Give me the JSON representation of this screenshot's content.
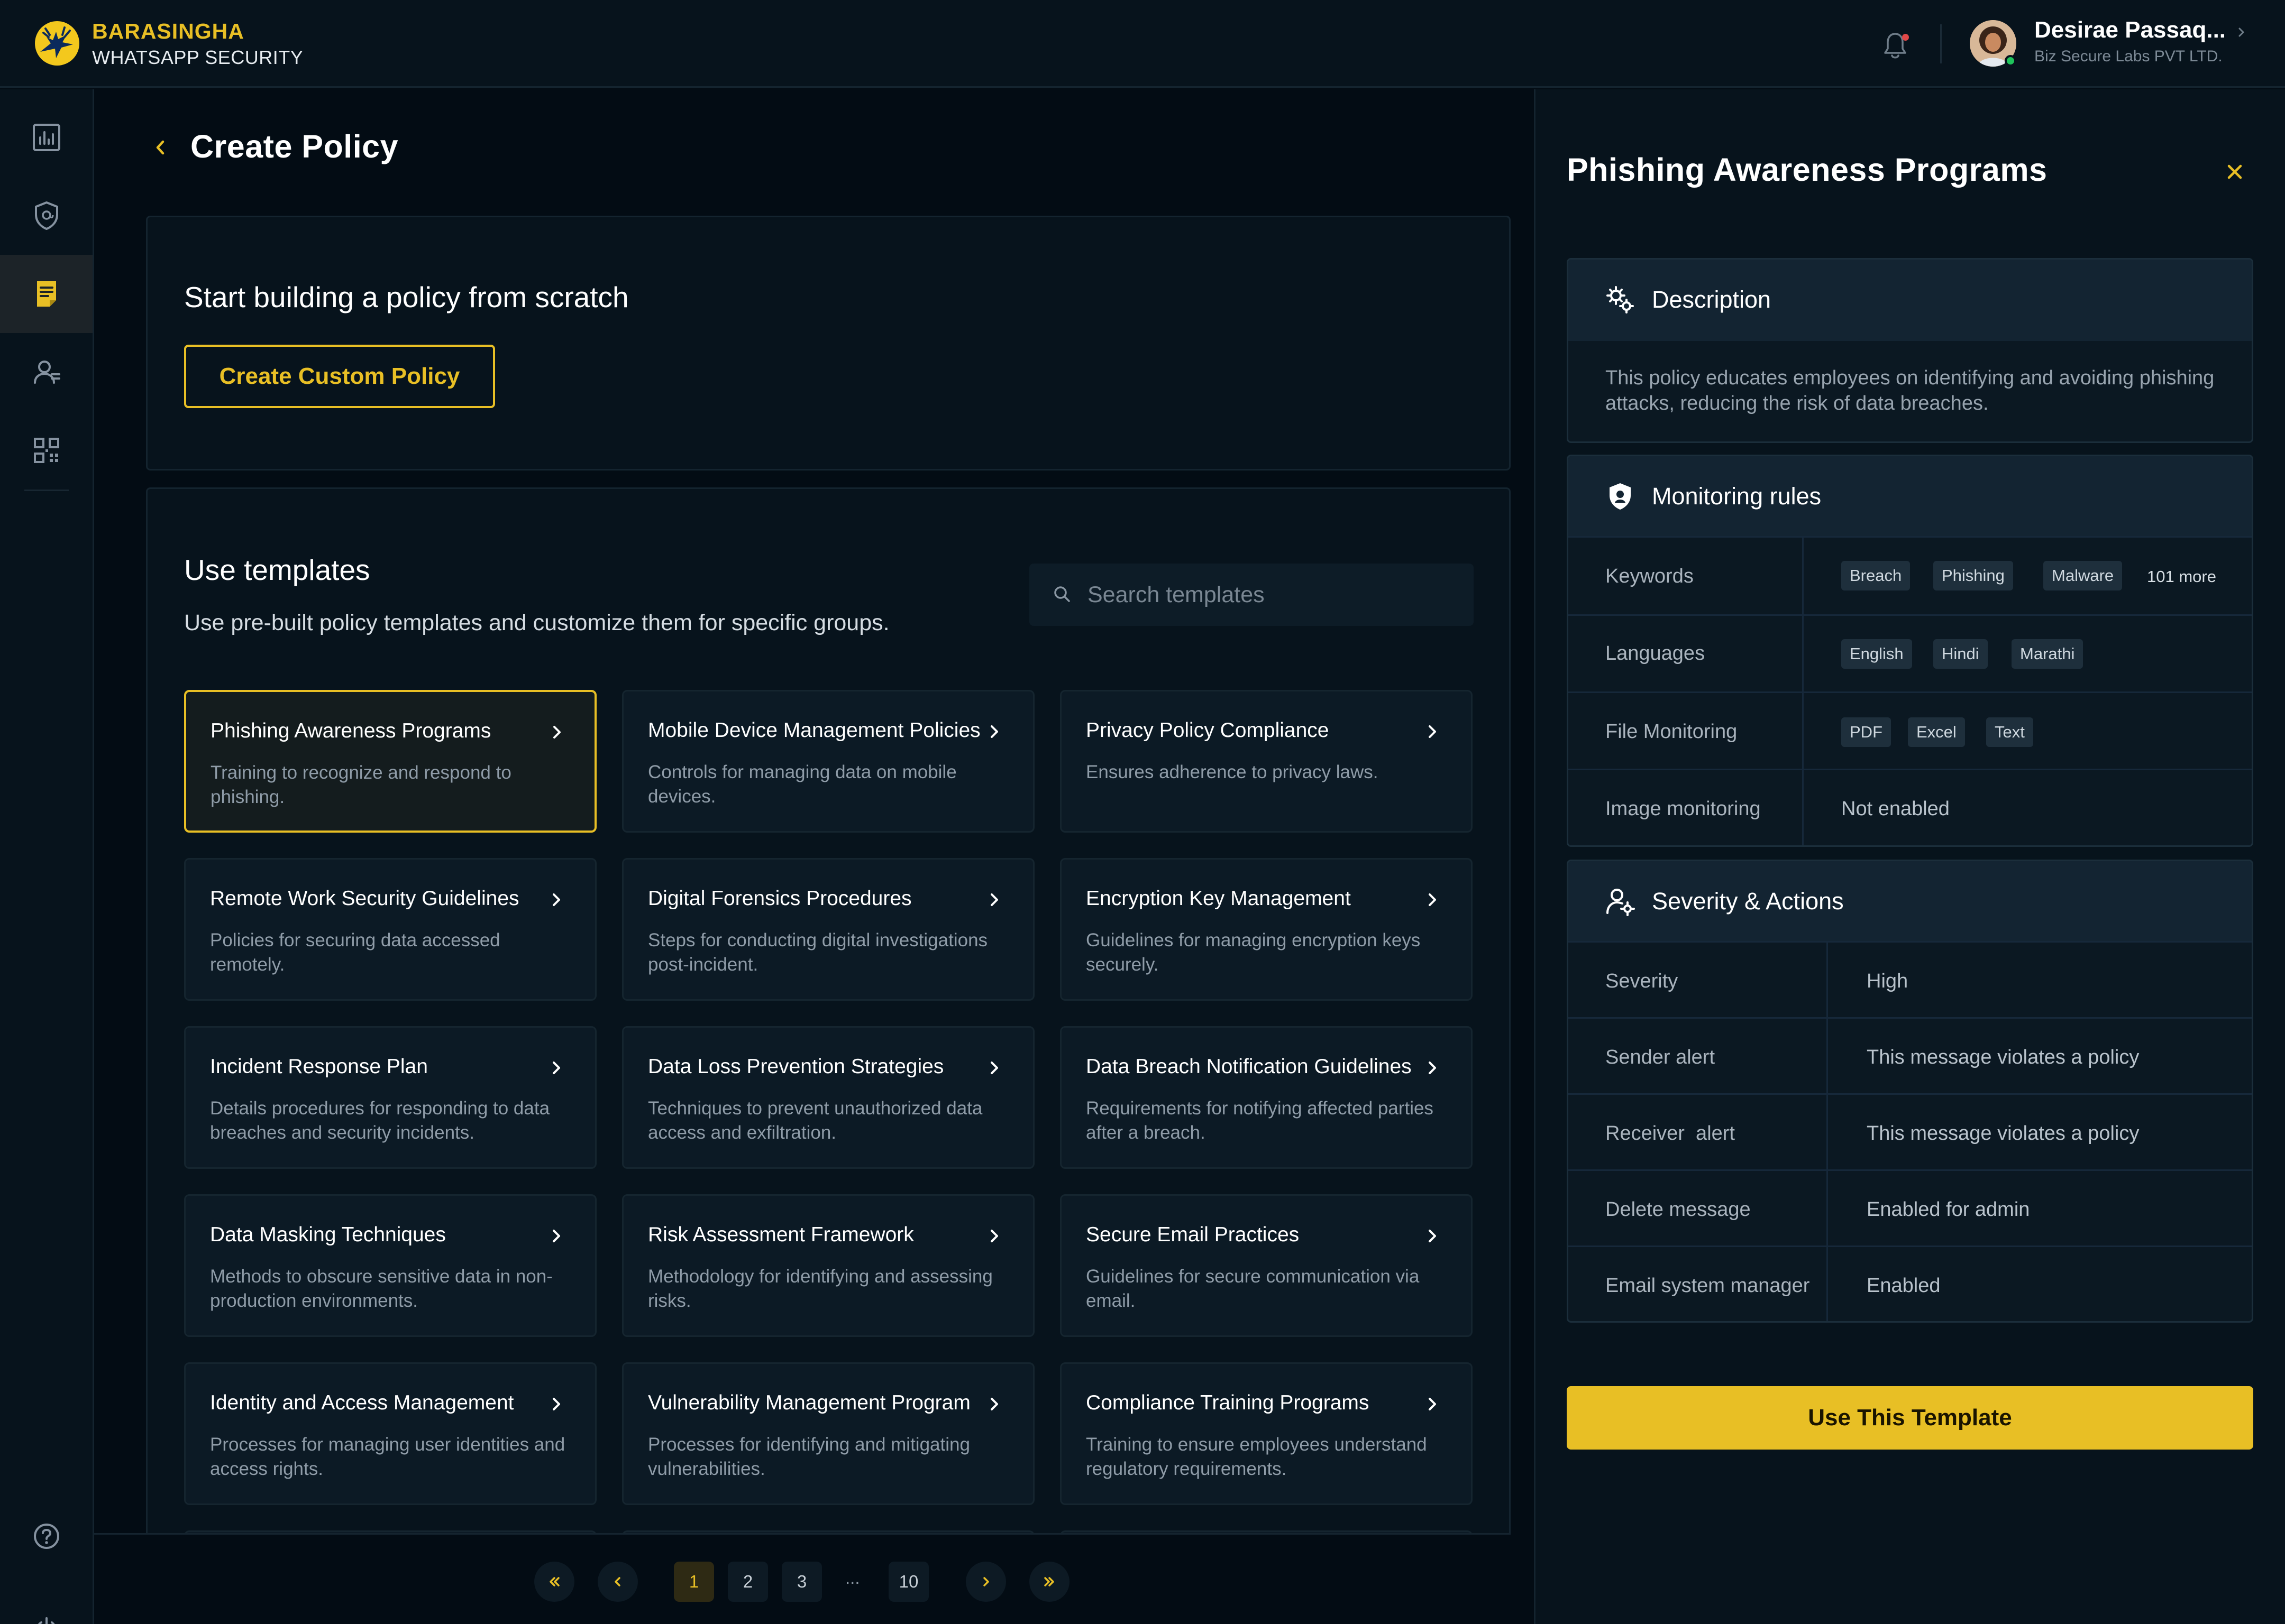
{
  "brand": {
    "name": "BARASINGHA",
    "subtitle": "WHATSAPP SECURITY"
  },
  "user": {
    "name": "Desirae Passaq...",
    "org": "Biz Secure Labs PVT LTD."
  },
  "page": {
    "title": "Create Policy"
  },
  "scratch": {
    "title": "Start building a policy from scratch",
    "button": "Create Custom Policy"
  },
  "templates": {
    "title": "Use templates",
    "subtitle": "Use pre-built policy templates and customize them for specific groups.",
    "search_placeholder": "Search templates",
    "cards": [
      {
        "title": "Phishing Awareness Programs",
        "desc": "Training to recognize and respond to phishing."
      },
      {
        "title": "Mobile Device Management Policies",
        "desc": "Controls for managing data on mobile devices."
      },
      {
        "title": "Privacy Policy Compliance",
        "desc": "Ensures adherence to privacy laws."
      },
      {
        "title": "Remote Work Security Guidelines",
        "desc": "Policies for securing data accessed remotely."
      },
      {
        "title": "Digital Forensics Procedures",
        "desc": "Steps for conducting digital investigations post-incident."
      },
      {
        "title": "Encryption Key Management",
        "desc": "Guidelines for managing encryption keys securely."
      },
      {
        "title": "Incident Response Plan",
        "desc": "Details procedures for responding to data breaches and security incidents."
      },
      {
        "title": "Data Loss Prevention Strategies",
        "desc": "Techniques to prevent unauthorized data access and exfiltration."
      },
      {
        "title": "Data Breach Notification Guidelines",
        "desc": "Requirements for notifying affected parties after a breach."
      },
      {
        "title": "Data Masking Techniques",
        "desc": "Methods to obscure sensitive data in non-production environments."
      },
      {
        "title": "Risk Assessment Framework",
        "desc": "Methodology for identifying and assessing risks."
      },
      {
        "title": "Secure Email Practices",
        "desc": "Guidelines for secure communication via email."
      },
      {
        "title": "Identity and Access Management",
        "desc": "Processes for managing user identities and access rights."
      },
      {
        "title": "Vulnerability Management Program",
        "desc": "Processes for identifying and mitigating vulnerabilities."
      },
      {
        "title": "Compliance Training Programs",
        "desc": "Training to ensure employees understand regulatory requirements."
      }
    ]
  },
  "pagination": {
    "pages": [
      "1",
      "2",
      "3",
      "10"
    ],
    "ellipsis": "...",
    "current": "1"
  },
  "detail": {
    "title": "Phishing Awareness Programs",
    "description": {
      "heading": "Description",
      "text": "This policy educates employees on identifying and avoiding phishing attacks, reducing the risk of data breaches."
    },
    "monitoring": {
      "heading": "Monitoring rules",
      "keywords": {
        "label": "Keywords",
        "tags": [
          "Breach",
          "Phishing",
          "Malware"
        ],
        "more": "101 more"
      },
      "languages": {
        "label": "Languages",
        "tags": [
          "English",
          "Hindi",
          "Marathi"
        ]
      },
      "files": {
        "label": "File Monitoring",
        "tags": [
          "PDF",
          "Excel",
          "Text"
        ]
      },
      "image": {
        "label": "Image monitoring",
        "value": "Not enabled"
      }
    },
    "severity": {
      "heading": "Severity & Actions",
      "rows": [
        {
          "label": "Severity",
          "value": "High"
        },
        {
          "label": "Sender alert",
          "value": "This message violates a policy"
        },
        {
          "label": "Receiver  alert",
          "value": "This message violates a policy"
        },
        {
          "label": "Delete message",
          "value": "Enabled for admin"
        },
        {
          "label": "Email system manager",
          "value": "Enabled"
        }
      ]
    },
    "button": "Use This Template"
  },
  "colors": {
    "accent": "#e8bf25",
    "background": "#030c14",
    "card": "#0c1a25",
    "online": "#1fc45b",
    "notification": "#e04848"
  },
  "icons": {
    "sidebar": [
      "chart-icon",
      "shield-icon",
      "policy-icon",
      "users-icon",
      "qr-code-icon",
      "help-icon",
      "power-icon"
    ],
    "header": [
      "bell-icon",
      "chevron-right-icon"
    ]
  }
}
